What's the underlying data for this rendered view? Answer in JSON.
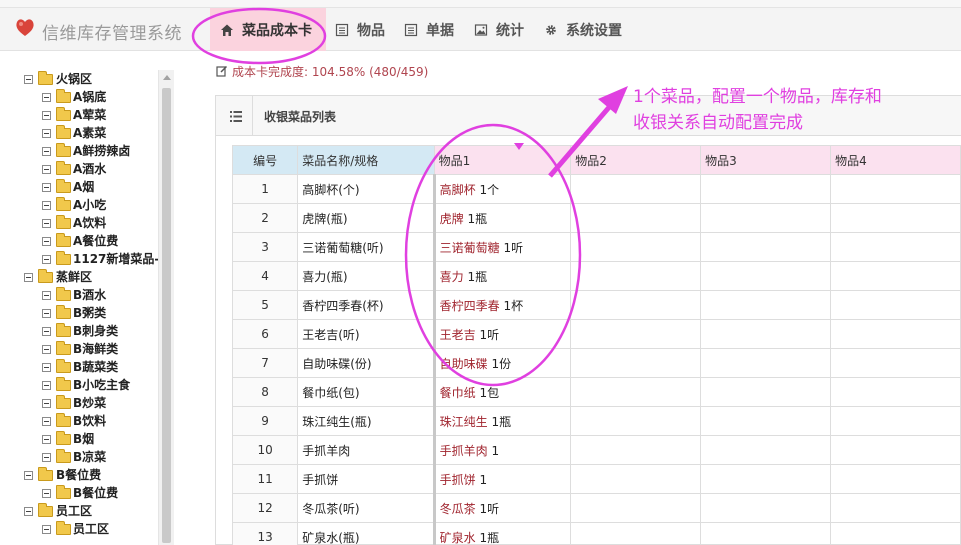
{
  "header": {
    "app_title": "信维库存管理系统",
    "nav": [
      {
        "label": "菜品成本卡",
        "icon": "home-icon",
        "active": true
      },
      {
        "label": "物品",
        "icon": "list-icon",
        "active": false
      },
      {
        "label": "单据",
        "icon": "list-icon",
        "active": false
      },
      {
        "label": "统计",
        "icon": "image-icon",
        "active": false
      },
      {
        "label": "系统设置",
        "icon": "gear-icon",
        "active": false
      }
    ]
  },
  "sidebar": {
    "tree": [
      {
        "label": "火锅区",
        "level": 1
      },
      {
        "label": "A锅底",
        "level": 2
      },
      {
        "label": "A荤菜",
        "level": 2
      },
      {
        "label": "A素菜",
        "level": 2
      },
      {
        "label": "A鲜捞辣卤",
        "level": 2
      },
      {
        "label": "A酒水",
        "level": 2
      },
      {
        "label": "A烟",
        "level": 2
      },
      {
        "label": "A小吃",
        "level": 2
      },
      {
        "label": "A饮料",
        "level": 2
      },
      {
        "label": "A餐位费",
        "level": 2
      },
      {
        "label": "1127新增菜品-...",
        "level": 2
      },
      {
        "label": "蒸鲜区",
        "level": 1
      },
      {
        "label": "B酒水",
        "level": 2
      },
      {
        "label": "B粥类",
        "level": 2
      },
      {
        "label": "B刺身类",
        "level": 2
      },
      {
        "label": "B海鲜类",
        "level": 2
      },
      {
        "label": "B蔬菜类",
        "level": 2
      },
      {
        "label": "B小吃主食",
        "level": 2
      },
      {
        "label": "B炒菜",
        "level": 2
      },
      {
        "label": "B饮料",
        "level": 2
      },
      {
        "label": "B烟",
        "level": 2
      },
      {
        "label": "B凉菜",
        "level": 2
      },
      {
        "label": "B餐位费",
        "level": 1
      },
      {
        "label": "B餐位费",
        "level": 2
      },
      {
        "label": "员工区",
        "level": 1
      },
      {
        "label": "员工区",
        "level": 2
      }
    ]
  },
  "progress": {
    "text": "成本卡完成度: 104.58% (480/459)"
  },
  "panel": {
    "title": "收银菜品列表"
  },
  "table": {
    "headers": [
      "编号",
      "菜品名称/规格",
      "物品1",
      "物品2",
      "物品3",
      "物品4"
    ],
    "rows": [
      {
        "num": "1",
        "name": "高脚杯(个)",
        "item_name": "高脚杯",
        "item_qty": "1个"
      },
      {
        "num": "2",
        "name": "虎牌(瓶)",
        "item_name": "虎牌",
        "item_qty": "1瓶"
      },
      {
        "num": "3",
        "name": "三诺葡萄糖(听)",
        "item_name": "三诺葡萄糖",
        "item_qty": "1听"
      },
      {
        "num": "4",
        "name": "喜力(瓶)",
        "item_name": "喜力",
        "item_qty": "1瓶"
      },
      {
        "num": "5",
        "name": "香柠四季春(杯)",
        "item_name": "香柠四季春",
        "item_qty": "1杯"
      },
      {
        "num": "6",
        "name": "王老吉(听)",
        "item_name": "王老吉",
        "item_qty": "1听"
      },
      {
        "num": "7",
        "name": "自助味碟(份)",
        "item_name": "自助味碟",
        "item_qty": "1份"
      },
      {
        "num": "8",
        "name": "餐巾纸(包)",
        "item_name": "餐巾纸",
        "item_qty": "1包"
      },
      {
        "num": "9",
        "name": "珠江纯生(瓶)",
        "item_name": "珠江纯生",
        "item_qty": "1瓶"
      },
      {
        "num": "10",
        "name": "手抓羊肉",
        "item_name": "手抓羊肉",
        "item_qty": "1"
      },
      {
        "num": "11",
        "name": "手抓饼",
        "item_name": "手抓饼",
        "item_qty": "1"
      },
      {
        "num": "12",
        "name": "冬瓜茶(听)",
        "item_name": "冬瓜茶",
        "item_qty": "1听"
      },
      {
        "num": "13",
        "name": "矿泉水(瓶)",
        "item_name": "矿泉水",
        "item_qty": "1瓶"
      }
    ]
  },
  "annotation": {
    "line1": "1个菜品，配置一个物品，库存和",
    "line2": "收银关系自动配置完成",
    "color": "#e040e0"
  },
  "colors": {
    "active_tab": "#fbd3de",
    "item_link": "#a0242e",
    "header_pink": "#fbe1ef",
    "header_blue": "#d4e9f4"
  }
}
